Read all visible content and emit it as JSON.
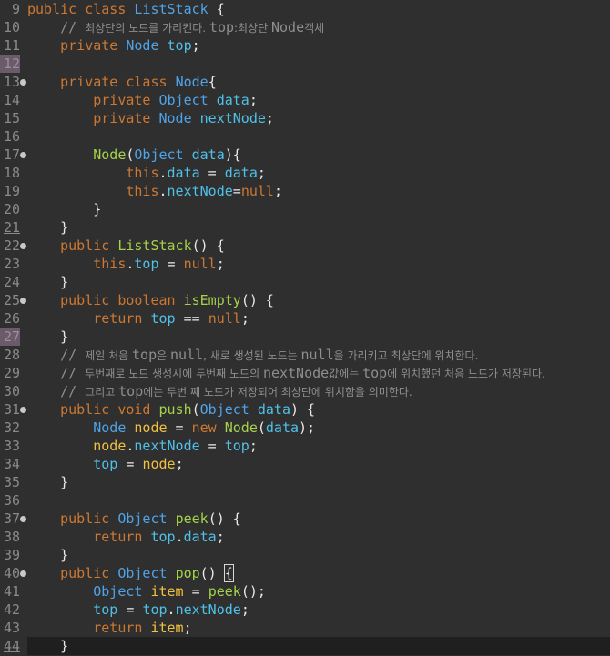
{
  "editor": {
    "line_numbers": [
      "9",
      "10",
      "11",
      "12",
      "13",
      "14",
      "15",
      "16",
      "17",
      "18",
      "19",
      "20",
      "21",
      "22",
      "23",
      "24",
      "25",
      "26",
      "27",
      "28",
      "29",
      "30",
      "31",
      "32",
      "33",
      "34",
      "35",
      "36",
      "37",
      "38",
      "39",
      "40",
      "41",
      "42",
      "43",
      "44"
    ],
    "lines": [
      [
        [
          "kw",
          "public"
        ],
        [
          "plain",
          " "
        ],
        [
          "kw",
          "class"
        ],
        [
          "plain",
          " "
        ],
        [
          "cls",
          "ListStack"
        ],
        [
          "plain",
          " {"
        ]
      ],
      [
        [
          "cmm",
          "    // "
        ],
        [
          "cm",
          "최상단의 노드를 가리킨다. "
        ],
        [
          "cmm",
          "top"
        ],
        [
          "cm",
          ":최상단 "
        ],
        [
          "cmm",
          "Node"
        ],
        [
          "cm",
          "객체"
        ]
      ],
      [
        [
          "plain",
          "    "
        ],
        [
          "kw",
          "private"
        ],
        [
          "plain",
          " "
        ],
        [
          "cls",
          "Node"
        ],
        [
          "plain",
          " "
        ],
        [
          "field",
          "top"
        ],
        [
          "plain",
          ";"
        ]
      ],
      [
        [
          "plain",
          ""
        ]
      ],
      [
        [
          "plain",
          "    "
        ],
        [
          "kw",
          "private"
        ],
        [
          "plain",
          " "
        ],
        [
          "kw",
          "class"
        ],
        [
          "plain",
          " "
        ],
        [
          "cls",
          "Node"
        ],
        [
          "plain",
          "{"
        ]
      ],
      [
        [
          "plain",
          "        "
        ],
        [
          "kw",
          "private"
        ],
        [
          "plain",
          " "
        ],
        [
          "cls",
          "Object"
        ],
        [
          "plain",
          " "
        ],
        [
          "field",
          "data"
        ],
        [
          "plain",
          ";"
        ]
      ],
      [
        [
          "plain",
          "        "
        ],
        [
          "kw",
          "private"
        ],
        [
          "plain",
          " "
        ],
        [
          "cls",
          "Node"
        ],
        [
          "plain",
          " "
        ],
        [
          "field",
          "nextNode"
        ],
        [
          "plain",
          ";"
        ]
      ],
      [
        [
          "plain",
          ""
        ]
      ],
      [
        [
          "plain",
          "        "
        ],
        [
          "fn",
          "Node"
        ],
        [
          "plain",
          "("
        ],
        [
          "cls",
          "Object"
        ],
        [
          "plain",
          " "
        ],
        [
          "field",
          "data"
        ],
        [
          "plain",
          "){"
        ]
      ],
      [
        [
          "plain",
          "            "
        ],
        [
          "this",
          "this"
        ],
        [
          "plain",
          "."
        ],
        [
          "field",
          "data"
        ],
        [
          "plain",
          " = "
        ],
        [
          "field",
          "data"
        ],
        [
          "plain",
          ";"
        ]
      ],
      [
        [
          "plain",
          "            "
        ],
        [
          "this",
          "this"
        ],
        [
          "plain",
          "."
        ],
        [
          "field",
          "nextNode"
        ],
        [
          "plain",
          "="
        ],
        [
          "null",
          "null"
        ],
        [
          "plain",
          ";"
        ]
      ],
      [
        [
          "plain",
          "        }"
        ]
      ],
      [
        [
          "plain",
          "    }"
        ]
      ],
      [
        [
          "plain",
          "    "
        ],
        [
          "kw",
          "public"
        ],
        [
          "plain",
          " "
        ],
        [
          "fn",
          "ListStack"
        ],
        [
          "plain",
          "() {"
        ]
      ],
      [
        [
          "plain",
          "        "
        ],
        [
          "this",
          "this"
        ],
        [
          "plain",
          "."
        ],
        [
          "field",
          "top"
        ],
        [
          "plain",
          " = "
        ],
        [
          "null",
          "null"
        ],
        [
          "plain",
          ";"
        ]
      ],
      [
        [
          "plain",
          "    }"
        ]
      ],
      [
        [
          "plain",
          "    "
        ],
        [
          "kw",
          "public"
        ],
        [
          "plain",
          " "
        ],
        [
          "kw",
          "boolean"
        ],
        [
          "plain",
          " "
        ],
        [
          "fn",
          "isEmpty"
        ],
        [
          "plain",
          "() {"
        ]
      ],
      [
        [
          "plain",
          "        "
        ],
        [
          "kw",
          "return"
        ],
        [
          "plain",
          " "
        ],
        [
          "field",
          "top"
        ],
        [
          "plain",
          " == "
        ],
        [
          "null",
          "null"
        ],
        [
          "plain",
          ";"
        ]
      ],
      [
        [
          "plain",
          "    }"
        ]
      ],
      [
        [
          "cmm",
          "    // "
        ],
        [
          "cm",
          "제일 처음 "
        ],
        [
          "cmm",
          "top"
        ],
        [
          "cm",
          "은 "
        ],
        [
          "cmm",
          "null"
        ],
        [
          "cm",
          ", 새로 생성된 노드는 "
        ],
        [
          "cmm",
          "null"
        ],
        [
          "cm",
          "을 가리키고 최상단에 위치한다."
        ]
      ],
      [
        [
          "cmm",
          "    // "
        ],
        [
          "cm",
          "두번째로 노드 생성시에 두번째 노드의 "
        ],
        [
          "cmm",
          "nextNode"
        ],
        [
          "cm",
          "값에는 "
        ],
        [
          "cmm",
          "top"
        ],
        [
          "cm",
          "에 위치했던 처음 노드가 저장된다."
        ]
      ],
      [
        [
          "cmm",
          "    // "
        ],
        [
          "cm",
          "그리고 "
        ],
        [
          "cmm",
          "top"
        ],
        [
          "cm",
          "에는 두번 째 노드가 저장되어 최상단에 위치함을 의미한다."
        ]
      ],
      [
        [
          "plain",
          "    "
        ],
        [
          "kw",
          "public"
        ],
        [
          "plain",
          " "
        ],
        [
          "kw",
          "void"
        ],
        [
          "plain",
          " "
        ],
        [
          "fn",
          "push"
        ],
        [
          "plain",
          "("
        ],
        [
          "cls",
          "Object"
        ],
        [
          "plain",
          " "
        ],
        [
          "field",
          "data"
        ],
        [
          "plain",
          ") {"
        ]
      ],
      [
        [
          "plain",
          "        "
        ],
        [
          "cls",
          "Node"
        ],
        [
          "plain",
          " "
        ],
        [
          "var",
          "node"
        ],
        [
          "plain",
          " = "
        ],
        [
          "kw",
          "new"
        ],
        [
          "plain",
          " "
        ],
        [
          "fn",
          "Node"
        ],
        [
          "plain",
          "("
        ],
        [
          "field",
          "data"
        ],
        [
          "plain",
          ");"
        ]
      ],
      [
        [
          "plain",
          "        "
        ],
        [
          "var",
          "node"
        ],
        [
          "plain",
          "."
        ],
        [
          "field",
          "nextNode"
        ],
        [
          "plain",
          " = "
        ],
        [
          "field",
          "top"
        ],
        [
          "plain",
          ";"
        ]
      ],
      [
        [
          "plain",
          "        "
        ],
        [
          "field",
          "top"
        ],
        [
          "plain",
          " = "
        ],
        [
          "var",
          "node"
        ],
        [
          "plain",
          ";"
        ]
      ],
      [
        [
          "plain",
          "    }"
        ]
      ],
      [
        [
          "plain",
          ""
        ]
      ],
      [
        [
          "plain",
          "    "
        ],
        [
          "kw",
          "public"
        ],
        [
          "plain",
          " "
        ],
        [
          "cls",
          "Object"
        ],
        [
          "plain",
          " "
        ],
        [
          "fn",
          "peek"
        ],
        [
          "plain",
          "() {"
        ]
      ],
      [
        [
          "plain",
          "        "
        ],
        [
          "kw",
          "return"
        ],
        [
          "plain",
          " "
        ],
        [
          "field",
          "top"
        ],
        [
          "plain",
          "."
        ],
        [
          "field",
          "data"
        ],
        [
          "plain",
          ";"
        ]
      ],
      [
        [
          "plain",
          "    }"
        ]
      ],
      [
        [
          "plain",
          "    "
        ],
        [
          "kw",
          "public"
        ],
        [
          "plain",
          " "
        ],
        [
          "cls",
          "Object"
        ],
        [
          "plain",
          " "
        ],
        [
          "fn",
          "pop"
        ],
        [
          "plain",
          "() "
        ],
        [
          "caret",
          "{"
        ]
      ],
      [
        [
          "plain",
          "        "
        ],
        [
          "cls",
          "Object"
        ],
        [
          "plain",
          " "
        ],
        [
          "var",
          "item"
        ],
        [
          "plain",
          " = "
        ],
        [
          "fn",
          "peek"
        ],
        [
          "plain",
          "();"
        ]
      ],
      [
        [
          "plain",
          "        "
        ],
        [
          "field",
          "top"
        ],
        [
          "plain",
          " = "
        ],
        [
          "field",
          "top"
        ],
        [
          "plain",
          "."
        ],
        [
          "field",
          "nextNode"
        ],
        [
          "plain",
          ";"
        ]
      ],
      [
        [
          "plain",
          "        "
        ],
        [
          "kw",
          "return"
        ],
        [
          "plain",
          " "
        ],
        [
          "var",
          "item"
        ],
        [
          "plain",
          ";"
        ]
      ],
      [
        [
          "plain",
          "    }"
        ]
      ]
    ]
  }
}
